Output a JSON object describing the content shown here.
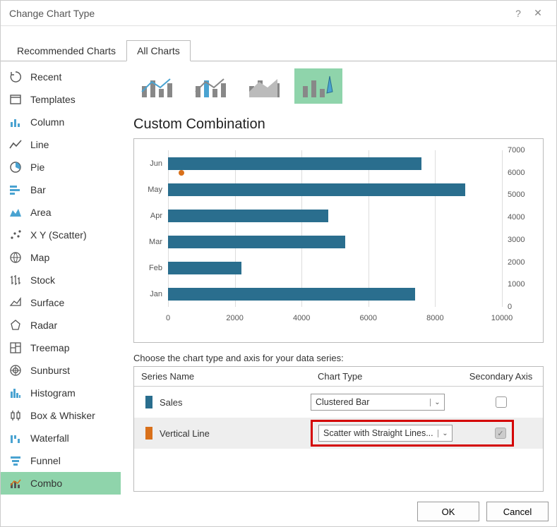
{
  "dialog": {
    "title": "Change Chart Type",
    "help": "?",
    "close": "✕"
  },
  "tabs": {
    "recommended": "Recommended Charts",
    "all": "All Charts"
  },
  "sidebar": {
    "items": [
      {
        "label": "Recent"
      },
      {
        "label": "Templates"
      },
      {
        "label": "Column"
      },
      {
        "label": "Line"
      },
      {
        "label": "Pie"
      },
      {
        "label": "Bar"
      },
      {
        "label": "Area"
      },
      {
        "label": "X Y (Scatter)"
      },
      {
        "label": "Map"
      },
      {
        "label": "Stock"
      },
      {
        "label": "Surface"
      },
      {
        "label": "Radar"
      },
      {
        "label": "Treemap"
      },
      {
        "label": "Sunburst"
      },
      {
        "label": "Histogram"
      },
      {
        "label": "Box & Whisker"
      },
      {
        "label": "Waterfall"
      },
      {
        "label": "Funnel"
      },
      {
        "label": "Combo"
      }
    ]
  },
  "main": {
    "heading": "Custom Combination",
    "legend_label": "Choose the chart type and axis for your data series:",
    "headers": {
      "name": "Series Name",
      "type": "Chart Type",
      "axis": "Secondary Axis"
    },
    "series": [
      {
        "name": "Sales",
        "color": "#2a6e8e",
        "chart_type": "Clustered Bar",
        "secondary": false
      },
      {
        "name": "Vertical Line",
        "color": "#d9701a",
        "chart_type": "Scatter with Straight Lines...",
        "secondary": true
      }
    ]
  },
  "footer": {
    "ok": "OK",
    "cancel": "Cancel"
  },
  "chart_data": {
    "type": "bar",
    "categories": [
      "Jan",
      "Feb",
      "Mar",
      "Apr",
      "May",
      "Jun"
    ],
    "values": [
      7400,
      2200,
      5300,
      4800,
      8900,
      7600
    ],
    "xlabel": "",
    "ylabel": "",
    "xlim": [
      0,
      10000
    ],
    "xticks": [
      0,
      2000,
      4000,
      6000,
      8000,
      10000
    ],
    "secondary": {
      "type": "scatter",
      "points": [
        {
          "x": 400,
          "y": 6000
        }
      ],
      "ylim": [
        0,
        7000
      ],
      "yticks": [
        0,
        1000,
        2000,
        3000,
        4000,
        5000,
        6000,
        7000
      ]
    }
  }
}
